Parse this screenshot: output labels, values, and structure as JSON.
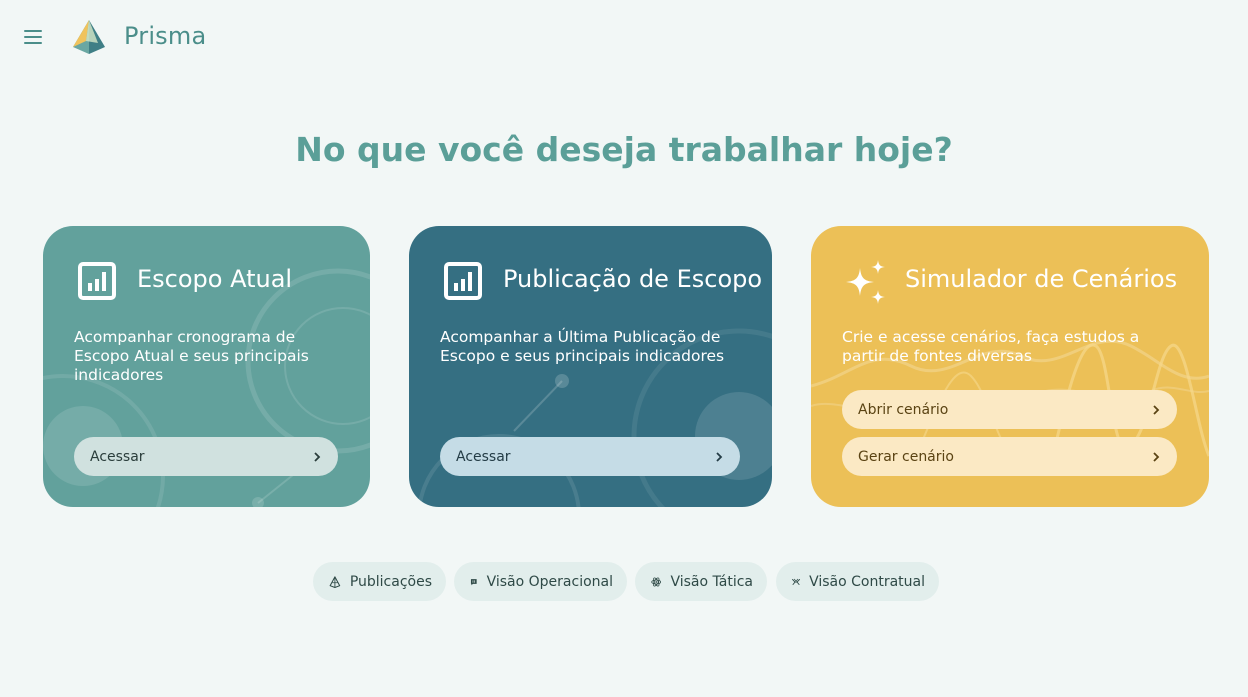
{
  "app": {
    "title": "Prisma"
  },
  "headline": "No que você deseja trabalhar hoje?",
  "cards": [
    {
      "title": "Escopo Atual",
      "description": "Acompanhar cronograma de Escopo Atual e seus principais indicadores",
      "icon": "bar-chart-icon",
      "buttons": [
        {
          "label": "Acessar"
        }
      ],
      "color": "#62a19c"
    },
    {
      "title": "Publicação de Escopo",
      "description": "Acompanhar a Última Publicação de Escopo e seus principais indicadores",
      "icon": "bar-chart-icon",
      "buttons": [
        {
          "label": "Acessar"
        }
      ],
      "color": "#356f82"
    },
    {
      "title": "Simulador de Cenários",
      "description": "Crie e acesse cenários, faça estudos a partir de fontes diversas",
      "icon": "sparkles-icon",
      "buttons": [
        {
          "label": "Abrir cenário"
        },
        {
          "label": "Gerar cenário"
        }
      ],
      "color": "#ecc057"
    }
  ],
  "quick_links": [
    {
      "label": "Publicações",
      "icon": "prism-icon"
    },
    {
      "label": "Visão Operacional",
      "icon": "chat-flag-icon"
    },
    {
      "label": "Visão Tática",
      "icon": "atom-icon"
    },
    {
      "label": "Visão Contratual",
      "icon": "handshake-icon"
    }
  ],
  "colors": {
    "accent": "#5b9f98",
    "background": "#f2f7f6"
  }
}
